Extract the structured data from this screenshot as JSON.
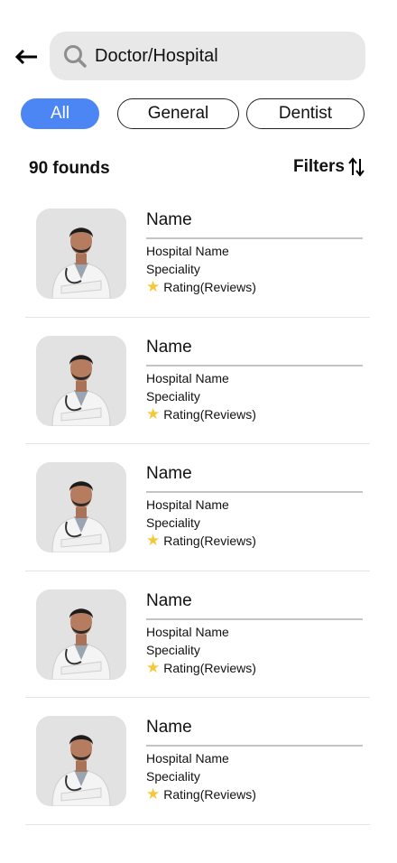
{
  "search": {
    "placeholder": "Doctor/Hospital",
    "value": ""
  },
  "chips": [
    {
      "label": "All",
      "selected": true
    },
    {
      "label": "General",
      "selected": false
    },
    {
      "label": "Dentist",
      "selected": false
    }
  ],
  "results": {
    "count_label": "90 founds",
    "filters_label": "Filters"
  },
  "doctors": [
    {
      "name": "Name",
      "hospital": "Hospital Name",
      "speciality": "Speciality",
      "rating": "Rating(Reviews)"
    },
    {
      "name": "Name",
      "hospital": "Hospital Name",
      "speciality": "Speciality",
      "rating": "Rating(Reviews)"
    },
    {
      "name": "Name",
      "hospital": "Hospital Name",
      "speciality": "Speciality",
      "rating": "Rating(Reviews)"
    },
    {
      "name": "Name",
      "hospital": "Hospital Name",
      "speciality": "Speciality",
      "rating": "Rating(Reviews)"
    },
    {
      "name": "Name",
      "hospital": "Hospital Name",
      "speciality": "Speciality",
      "rating": "Rating(Reviews)"
    }
  ],
  "icons": {
    "back": "arrow-left-icon",
    "search": "search-icon",
    "sort": "sort-arrows-icon",
    "star": "star-icon"
  },
  "colors": {
    "accent": "#4c86f5",
    "search_bg": "#e8e8e8",
    "star": "#f5c83a"
  }
}
